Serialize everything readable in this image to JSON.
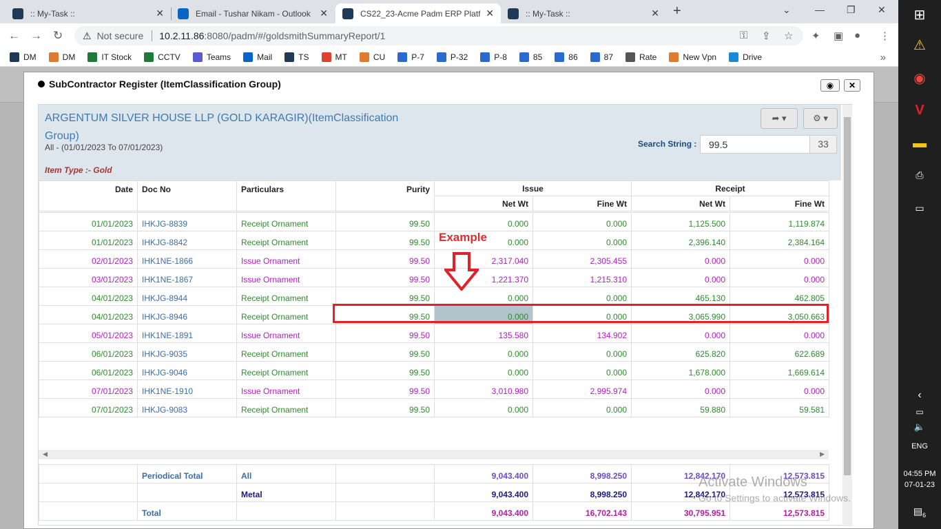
{
  "browser": {
    "tabs": [
      {
        "title": ":: My-Task ::",
        "icon_color": "#1f3a58"
      },
      {
        "title": "Email - Tushar Nikam - Outlook",
        "icon_color": "#0a64c8"
      },
      {
        "title": "CS22_23-Acme Padm ERP Platfor",
        "icon_color": "#1f3a58"
      },
      {
        "title": ":: My-Task ::",
        "icon_color": "#1f3a58"
      }
    ],
    "security": "Not secure",
    "url_host": "10.2.11.86",
    "url_rest": ":8080/padm/#/goldsmithSummaryReport/1",
    "bookmarks": [
      {
        "label": "DM",
        "color": "#1f3a58"
      },
      {
        "label": "DM",
        "color": "#e07a30"
      },
      {
        "label": "IT Stock",
        "color": "#1d7a3a"
      },
      {
        "label": "CCTV",
        "color": "#1d7a3a"
      },
      {
        "label": "Teams",
        "color": "#5a5ad0"
      },
      {
        "label": "Mail",
        "color": "#0a64c8"
      },
      {
        "label": "TS",
        "color": "#1f3a58"
      },
      {
        "label": "MT",
        "color": "#e04030"
      },
      {
        "label": "CU",
        "color": "#e07a30"
      },
      {
        "label": "P-7",
        "color": "#2a6ad0"
      },
      {
        "label": "P-32",
        "color": "#2a6ad0"
      },
      {
        "label": "P-8",
        "color": "#2a6ad0"
      },
      {
        "label": "85",
        "color": "#2a6ad0"
      },
      {
        "label": "86",
        "color": "#2a6ad0"
      },
      {
        "label": "87",
        "color": "#2a6ad0"
      },
      {
        "label": "Rate",
        "color": "#555555"
      },
      {
        "label": "New Vpn",
        "color": "#e07a30"
      },
      {
        "label": "Drive",
        "color": "#1a8ad8"
      }
    ]
  },
  "modal": {
    "title": "SubContractor Register (ItemClassification Group)",
    "company": "ARGENTUM SILVER HOUSE LLP (GOLD KARAGIR)(ItemClassification Group)",
    "period": "All - (01/01/2023 To 07/01/2023)",
    "item_type": "Item Type :- Gold",
    "search_label": "Search String :",
    "search_value": "99.5",
    "search_count": "33"
  },
  "columns": {
    "date": "Date",
    "doc": "Doc No",
    "particulars": "Particulars",
    "purity": "Purity",
    "issue": "Issue",
    "receipt": "Receipt",
    "net": "Net Wt",
    "fine": "Fine Wt"
  },
  "rows": [
    {
      "date": "01/01/2023",
      "doc": "IHKJG-8839",
      "part": "Receipt Ornament",
      "purity": "99.50",
      "inet": "0.000",
      "ifine": "0.000",
      "rnet": "1,125.500",
      "rfine": "1,119.874",
      "type": "g"
    },
    {
      "date": "01/01/2023",
      "doc": "IHKJG-8842",
      "part": "Receipt Ornament",
      "purity": "99.50",
      "inet": "0.000",
      "ifine": "0.000",
      "rnet": "2,396.140",
      "rfine": "2,384.164",
      "type": "g"
    },
    {
      "date": "02/01/2023",
      "doc": "IHK1NE-1866",
      "part": "Issue Ornament",
      "purity": "99.50",
      "inet": "2,317.040",
      "ifine": "2,305.455",
      "rnet": "0.000",
      "rfine": "0.000",
      "type": "p"
    },
    {
      "date": "03/01/2023",
      "doc": "IHK1NE-1867",
      "part": "Issue Ornament",
      "purity": "99.50",
      "inet": "1,221.370",
      "ifine": "1,215.310",
      "rnet": "0.000",
      "rfine": "0.000",
      "type": "p"
    },
    {
      "date": "04/01/2023",
      "doc": "IHKJG-8944",
      "part": "Receipt Ornament",
      "purity": "99.50",
      "inet": "0.000",
      "ifine": "0.000",
      "rnet": "465.130",
      "rfine": "462.805",
      "type": "g"
    },
    {
      "date": "04/01/2023",
      "doc": "IHKJG-8946",
      "part": "Receipt Ornament",
      "purity": "99.50",
      "inet": "0.000",
      "ifine": "0.000",
      "rnet": "3,065.990",
      "rfine": "3,050.663",
      "type": "g"
    },
    {
      "date": "05/01/2023",
      "doc": "IHK1NE-1891",
      "part": "Issue Ornament",
      "purity": "99.50",
      "inet": "135.580",
      "ifine": "134.902",
      "rnet": "0.000",
      "rfine": "0.000",
      "type": "p"
    },
    {
      "date": "06/01/2023",
      "doc": "IHKJG-9035",
      "part": "Receipt Ornament",
      "purity": "99.50",
      "inet": "0.000",
      "ifine": "0.000",
      "rnet": "625.820",
      "rfine": "622.689",
      "type": "g"
    },
    {
      "date": "06/01/2023",
      "doc": "IHKJG-9046",
      "part": "Receipt Ornament",
      "purity": "99.50",
      "inet": "0.000",
      "ifine": "0.000",
      "rnet": "1,678.000",
      "rfine": "1,669.614",
      "type": "g"
    },
    {
      "date": "07/01/2023",
      "doc": "IHK1NE-1910",
      "part": "Issue Ornament",
      "purity": "99.50",
      "inet": "3,010.980",
      "ifine": "2,995.974",
      "rnet": "0.000",
      "rfine": "0.000",
      "type": "p"
    },
    {
      "date": "07/01/2023",
      "doc": "IHKJG-9083",
      "part": "Receipt Ornament",
      "purity": "99.50",
      "inet": "0.000",
      "ifine": "0.000",
      "rnet": "59.880",
      "rfine": "59.581",
      "type": "g"
    }
  ],
  "footer": {
    "periodical_label": "Periodical Total",
    "all_label": "All",
    "metal_label": "Metal",
    "total_label": "Total",
    "all": {
      "inet": "9,043.400",
      "ifine": "8,998.250",
      "rnet": "12,842.170",
      "rfine": "12,573.815"
    },
    "metal": {
      "inet": "9,043.400",
      "ifine": "8,998.250",
      "rnet": "12,842.170",
      "rfine": "12,573.815"
    },
    "total": {
      "inet": "9,043.400",
      "ifine": "16,702.143",
      "rnet": "30,795.951",
      "rfine": "12,573.815"
    }
  },
  "annotation": {
    "label": "Example"
  },
  "watermark": {
    "line1": "Activate Windows",
    "line2": "Go to Settings to activate Windows."
  },
  "taskbar": {
    "lang": "ENG",
    "time": "04:55 PM",
    "date": "07-01-23",
    "notif": "6"
  }
}
